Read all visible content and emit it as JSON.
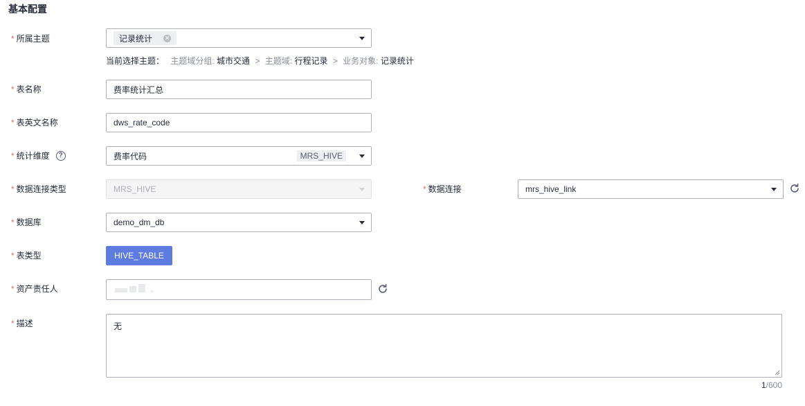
{
  "section_title": "基本配置",
  "colors": {
    "required": "#e06e6e",
    "primary": "#5e7ce0",
    "border": "#adb0b8"
  },
  "fields": {
    "theme": {
      "label": "所属主题",
      "tag": "记录统计"
    },
    "breadcrumb": {
      "prefix": "当前选择主题：",
      "group_label": "主题域分组:",
      "group_value": "城市交通",
      "sep1": ">",
      "domain_label": "主题域:",
      "domain_value": "行程记录",
      "sep2": ">",
      "object_label": "业务对象:",
      "object_value": "记录统计"
    },
    "table_name": {
      "label": "表名称",
      "value": "费率统计汇总"
    },
    "table_en_name": {
      "label": "表英文名称",
      "value": "dws_rate_code"
    },
    "dimension": {
      "label": "统计维度",
      "value": "费率代码",
      "badge": "MRS_HIVE",
      "help_icon": "question-circle-icon"
    },
    "conn_type": {
      "label": "数据连接类型",
      "value": "MRS_HIVE"
    },
    "connection": {
      "label": "数据连接",
      "value": "mrs_hive_link"
    },
    "database": {
      "label": "数据库",
      "value": "demo_dm_db"
    },
    "table_type": {
      "label": "表类型",
      "value": "HIVE_TABLE"
    },
    "owner": {
      "label": "资产责任人"
    },
    "description": {
      "label": "描述",
      "value": "无",
      "count": "1",
      "max": "/600"
    }
  },
  "required_mark": "*"
}
